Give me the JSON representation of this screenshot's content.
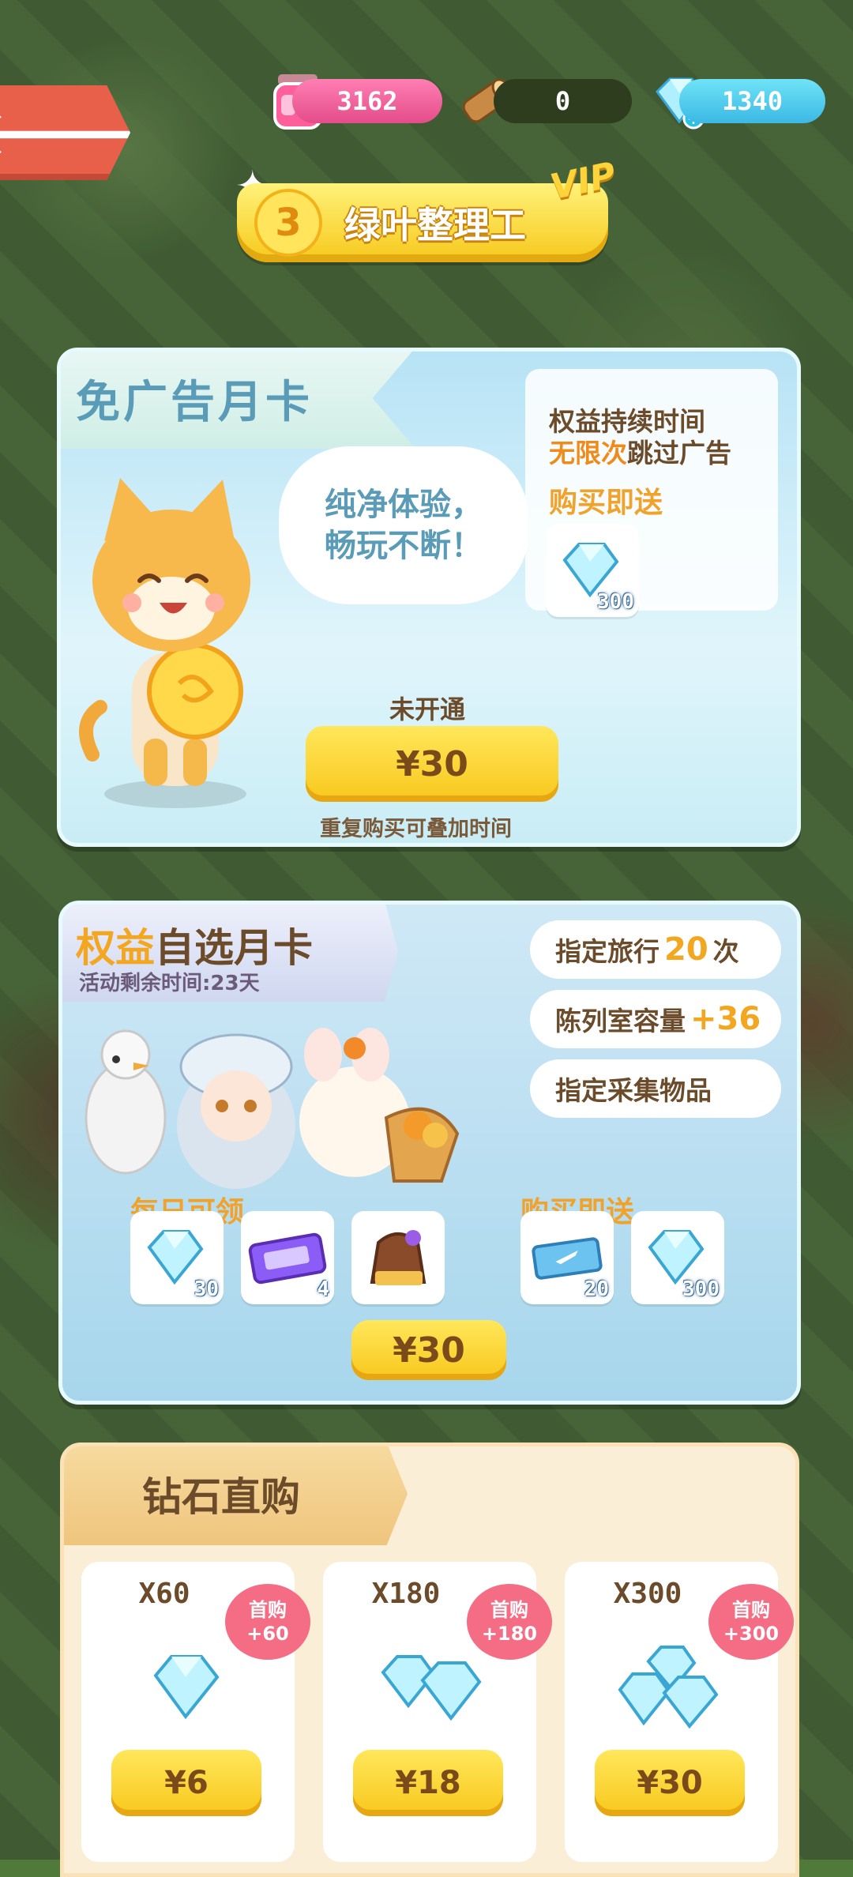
{
  "top_bar": {
    "back_label": "back",
    "jam": "3162",
    "wood": "0",
    "gems": "1340"
  },
  "vip": {
    "level": "3",
    "title": "绿叶整理工",
    "tag": "VIP"
  },
  "ad_free_card": {
    "title": "免广告月卡",
    "duration_label": "权益持续时间",
    "benefit_highlight": "无限次",
    "benefit_rest": "跳过广告",
    "bonus_label": "购买即送",
    "bonus_gems": "300",
    "bubble_line1": "纯净体验，",
    "bubble_line2": "畅玩不断！",
    "status": "未开通",
    "price": "¥30",
    "note": "重复购买可叠加时间"
  },
  "select_card": {
    "title_a": "权益",
    "title_b": "自选月卡",
    "remaining": "活动剩余时间:23天",
    "perk1_pre": "指定旅行",
    "perk1_num": "20",
    "perk1_post": "次",
    "perk2_pre": "陈列室容量",
    "perk2_num": "+36",
    "perk3": "指定采集物品",
    "daily_label": "每日可领",
    "daily_items": [
      {
        "icon": "gem",
        "count": "30"
      },
      {
        "icon": "ticket",
        "count": "4"
      },
      {
        "icon": "gift-bag",
        "count": ""
      }
    ],
    "bonus_label": "购买即送",
    "bonus_items": [
      {
        "icon": "flight-ticket",
        "count": "20"
      },
      {
        "icon": "gem",
        "count": "300"
      }
    ],
    "price": "¥30"
  },
  "diamond_shop": {
    "title": "钻石直购",
    "items": [
      {
        "qty": "X60",
        "first_label": "首购",
        "first_bonus": "+60",
        "price": "¥6"
      },
      {
        "qty": "X180",
        "first_label": "首购",
        "first_bonus": "+180",
        "price": "¥18"
      },
      {
        "qty": "X300",
        "first_label": "首购",
        "first_bonus": "+300",
        "price": "¥30"
      }
    ]
  }
}
